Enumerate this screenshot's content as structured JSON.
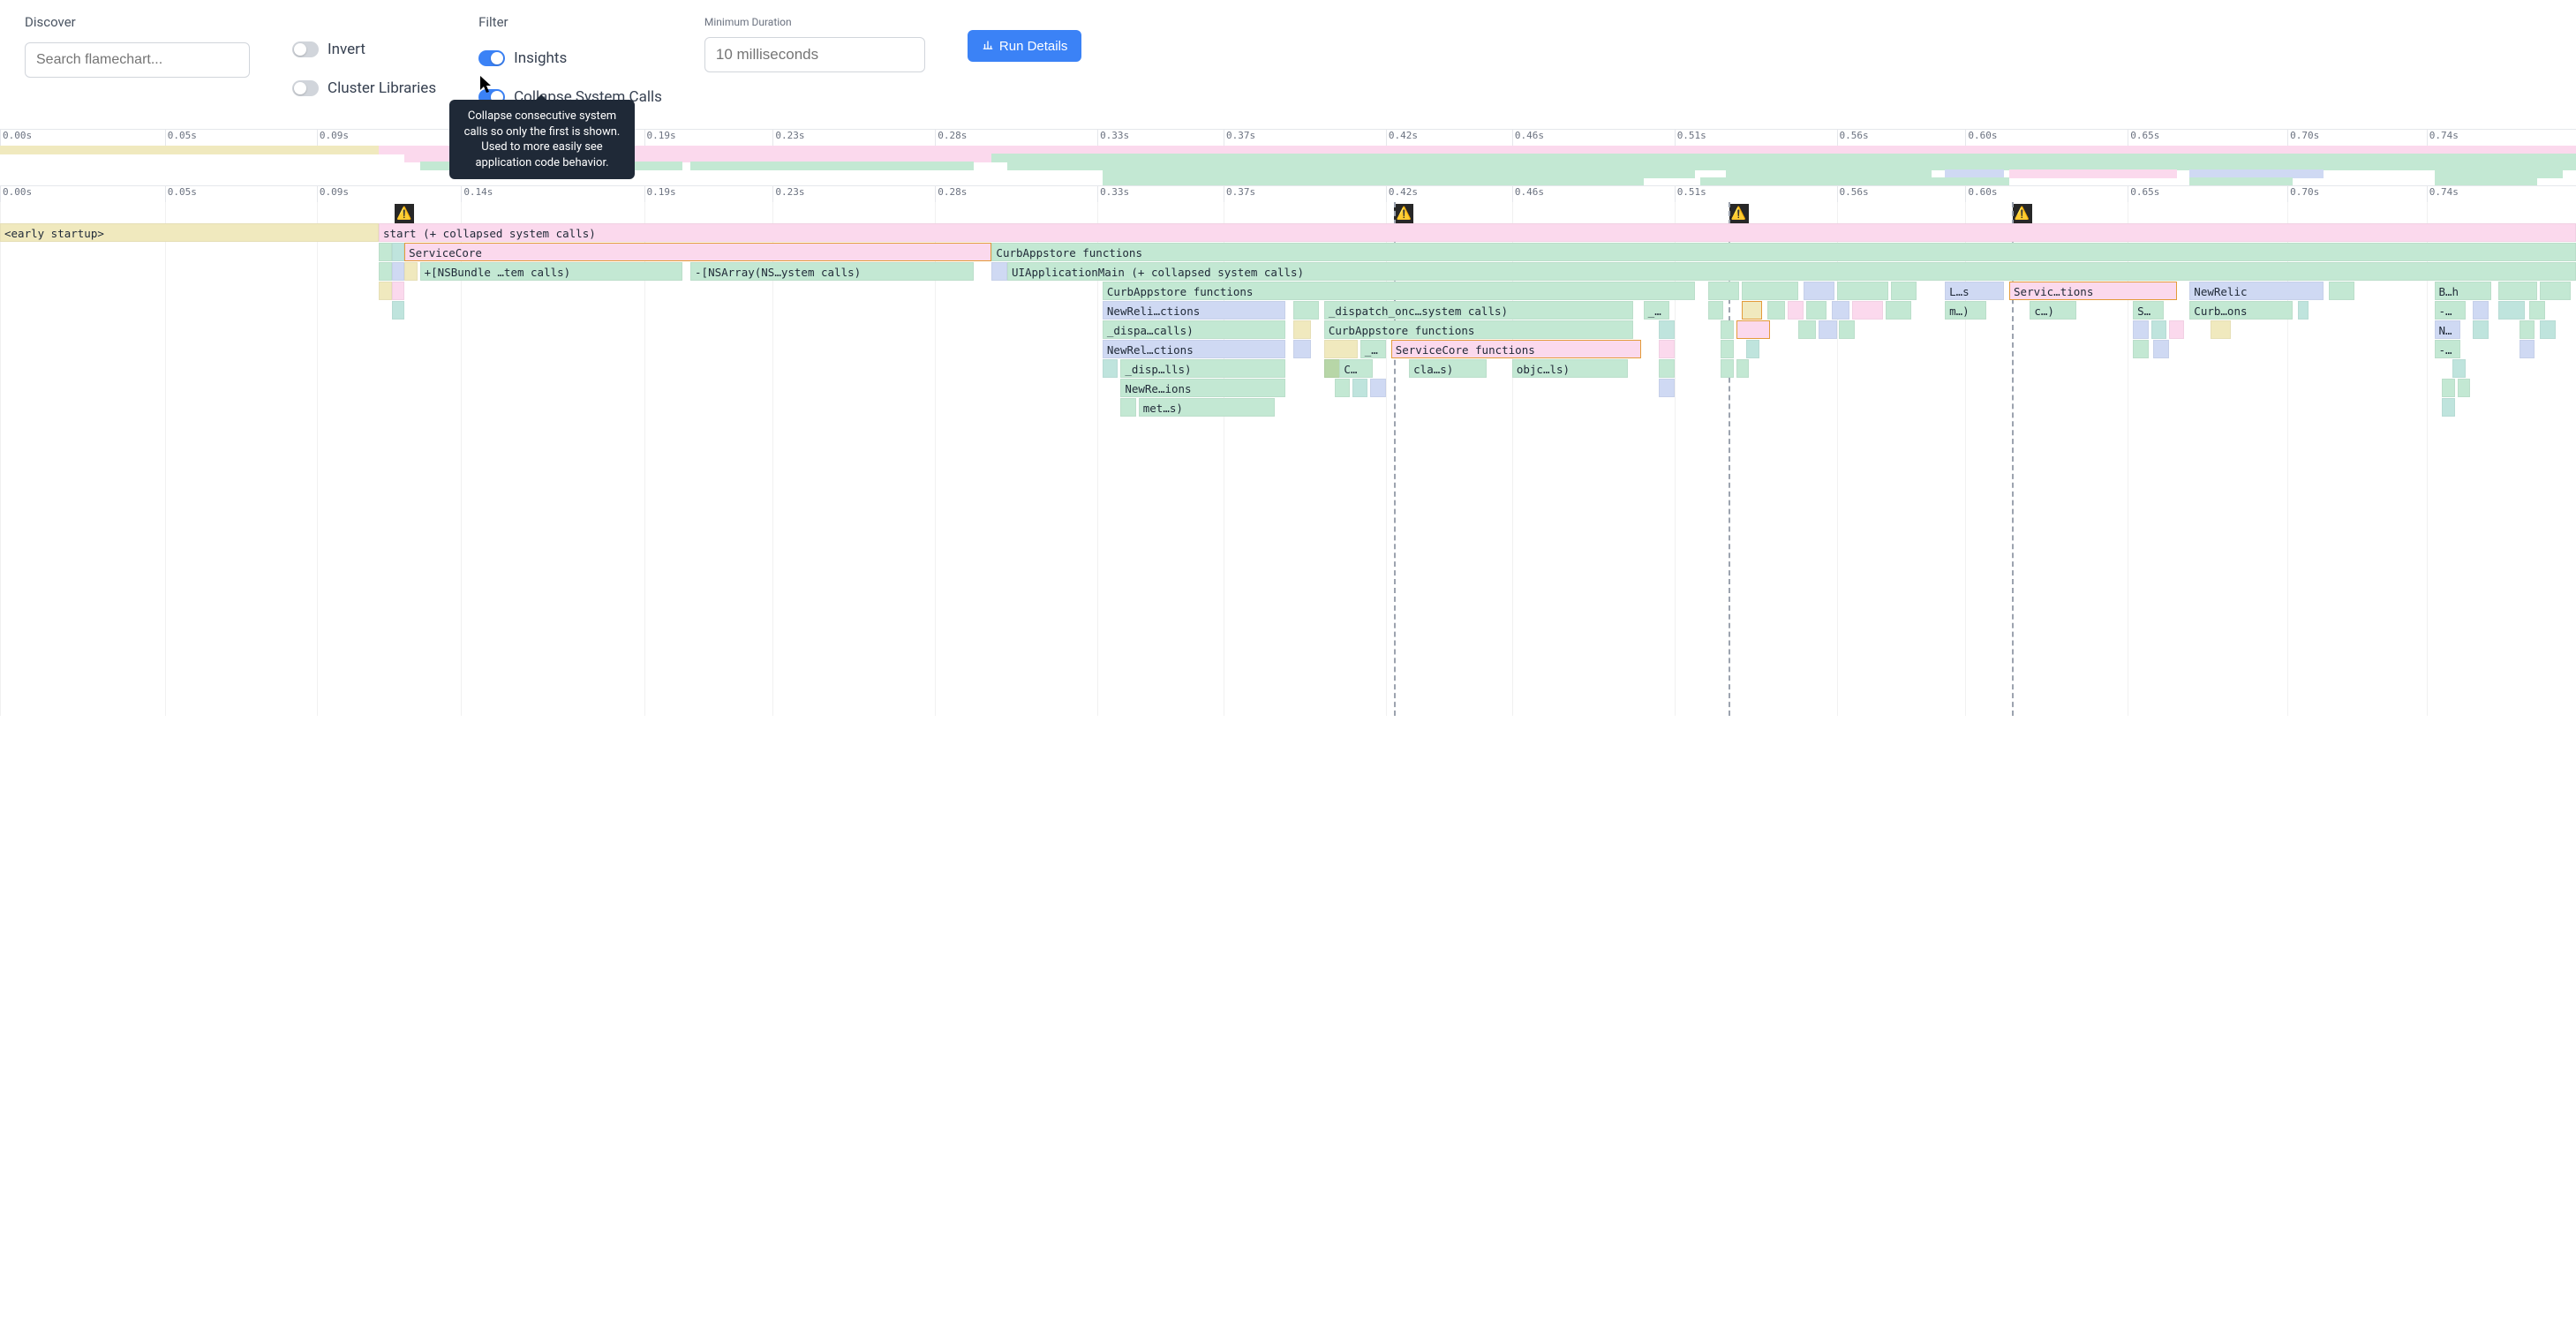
{
  "toolbar": {
    "discover_label": "Discover",
    "search_placeholder": "Search flamechart...",
    "invert_label": "Invert",
    "cluster_label": "Cluster Libraries",
    "filter_label": "Filter",
    "insights_label": "Insights",
    "collapse_label": "Collapse System Calls",
    "mindur_label": "Minimum Duration",
    "mindur_placeholder": "10 milliseconds",
    "run_label": "Run Details",
    "invert_on": false,
    "cluster_on": false,
    "insights_on": true,
    "collapse_on": true
  },
  "tooltip_text": "Collapse consecutive system calls so only the first is shown. Used to more easily see application code behavior.",
  "ruler_ticks": [
    "0.00s",
    "0.05s",
    "0.09s",
    "0.14s",
    "0.19s",
    "0.23s",
    "0.28s",
    "0.33s",
    "0.37s",
    "0.42s",
    "0.46s",
    "0.51s",
    "0.56s",
    "0.60s",
    "0.65s",
    "0.70s",
    "0.74s"
  ],
  "ruler_pct": [
    0,
    6.4,
    12.3,
    17.9,
    25.0,
    30.0,
    36.3,
    42.6,
    47.5,
    53.8,
    58.7,
    65.0,
    71.3,
    76.3,
    82.6,
    88.8,
    94.2,
    100
  ],
  "warnings_pct": [
    15.7,
    54.5,
    67.5,
    78.5
  ],
  "vdash_pct": [
    54.1,
    67.1,
    78.1
  ],
  "flame_rows": [
    [
      {
        "l": 0,
        "w": 14.7,
        "cls": "c-yellow",
        "txt": "<early startup>"
      },
      {
        "l": 14.7,
        "w": 85.3,
        "cls": "c-pink",
        "txt": "start (+ collapsed system calls)"
      }
    ],
    [
      {
        "l": 14.7,
        "w": 0.5,
        "cls": "c-green",
        "txt": ""
      },
      {
        "l": 15.2,
        "w": 0.5,
        "cls": "c-teal",
        "txt": ""
      },
      {
        "l": 15.7,
        "w": 22.8,
        "cls": "c-pink-b",
        "txt": "ServiceCore"
      },
      {
        "l": 38.5,
        "w": 61.5,
        "cls": "c-green",
        "txt": "CurbAppstore functions"
      }
    ],
    [
      {
        "l": 14.7,
        "w": 0.5,
        "cls": "c-green",
        "txt": ""
      },
      {
        "l": 15.2,
        "w": 0.5,
        "cls": "c-blue",
        "txt": ""
      },
      {
        "l": 15.7,
        "w": 0.5,
        "cls": "c-yellow",
        "txt": ""
      },
      {
        "l": 16.3,
        "w": 10.2,
        "cls": "c-green",
        "txt": "+[NSBundle …tem calls)"
      },
      {
        "l": 26.8,
        "w": 11.0,
        "cls": "c-green",
        "txt": "-[NSArray(NS…ystem calls)"
      },
      {
        "l": 38.5,
        "w": 0.6,
        "cls": "c-blue",
        "txt": ""
      },
      {
        "l": 39.1,
        "w": 60.9,
        "cls": "c-green",
        "txt": "UIApplicationMain (+ collapsed system calls)"
      }
    ],
    [
      {
        "l": 14.7,
        "w": 0.5,
        "cls": "c-yellow",
        "txt": ""
      },
      {
        "l": 15.2,
        "w": 0.5,
        "cls": "c-pink",
        "txt": ""
      },
      {
        "l": 42.8,
        "w": 23.0,
        "cls": "c-green",
        "txt": "CurbAppstore functions"
      },
      {
        "l": 66.3,
        "w": 1.2,
        "cls": "c-green",
        "txt": ""
      },
      {
        "l": 67.6,
        "w": 2.2,
        "cls": "c-green",
        "txt": ""
      },
      {
        "l": 70.0,
        "w": 1.2,
        "cls": "c-blue",
        "txt": ""
      },
      {
        "l": 71.3,
        "w": 2.0,
        "cls": "c-green",
        "txt": ""
      },
      {
        "l": 73.4,
        "w": 1.0,
        "cls": "c-green",
        "txt": ""
      },
      {
        "l": 75.5,
        "w": 2.3,
        "cls": "c-blue",
        "txt": "L…s"
      },
      {
        "l": 78.0,
        "w": 6.5,
        "cls": "c-pink-b",
        "txt": "Servic…tions"
      },
      {
        "l": 85.0,
        "w": 5.2,
        "cls": "c-blue",
        "txt": "NewRelic"
      },
      {
        "l": 90.4,
        "w": 1.0,
        "cls": "c-green",
        "txt": ""
      },
      {
        "l": 94.5,
        "w": 2.2,
        "cls": "c-green",
        "txt": "B…h"
      },
      {
        "l": 97.0,
        "w": 1.5,
        "cls": "c-green",
        "txt": ""
      },
      {
        "l": 98.6,
        "w": 1.2,
        "cls": "c-green",
        "txt": ""
      }
    ],
    [
      {
        "l": 15.2,
        "w": 0.5,
        "cls": "c-teal",
        "txt": ""
      },
      {
        "l": 42.8,
        "w": 7.1,
        "cls": "c-blue",
        "txt": "NewReli…ctions"
      },
      {
        "l": 50.2,
        "w": 1.0,
        "cls": "c-green",
        "txt": ""
      },
      {
        "l": 51.4,
        "w": 12.0,
        "cls": "c-green",
        "txt": "_dispatch_onc…system calls)"
      },
      {
        "l": 63.8,
        "w": 1.0,
        "cls": "c-green",
        "txt": "_…"
      },
      {
        "l": 66.3,
        "w": 0.6,
        "cls": "c-green",
        "txt": ""
      },
      {
        "l": 67.6,
        "w": 0.8,
        "cls": "c-yellow-b",
        "txt": ""
      },
      {
        "l": 68.6,
        "w": 0.7,
        "cls": "c-green",
        "txt": ""
      },
      {
        "l": 69.4,
        "w": 0.6,
        "cls": "c-pink",
        "txt": ""
      },
      {
        "l": 70.1,
        "w": 0.8,
        "cls": "c-green",
        "txt": ""
      },
      {
        "l": 71.1,
        "w": 0.7,
        "cls": "c-blue",
        "txt": ""
      },
      {
        "l": 71.9,
        "w": 1.2,
        "cls": "c-pink",
        "txt": ""
      },
      {
        "l": 73.2,
        "w": 1.0,
        "cls": "c-green",
        "txt": ""
      },
      {
        "l": 75.5,
        "w": 1.6,
        "cls": "c-green",
        "txt": "m…)"
      },
      {
        "l": 78.8,
        "w": 1.8,
        "cls": "c-green",
        "txt": "c…)"
      },
      {
        "l": 82.8,
        "w": 1.2,
        "cls": "c-green",
        "txt": "S…"
      },
      {
        "l": 85.0,
        "w": 4.0,
        "cls": "c-green",
        "txt": "Curb…ons"
      },
      {
        "l": 89.2,
        "w": 0.4,
        "cls": "c-teal",
        "txt": ""
      },
      {
        "l": 94.5,
        "w": 1.2,
        "cls": "c-green",
        "txt": "-…"
      },
      {
        "l": 96.0,
        "w": 0.6,
        "cls": "c-blue",
        "txt": ""
      },
      {
        "l": 97.0,
        "w": 1.0,
        "cls": "c-teal",
        "txt": ""
      },
      {
        "l": 98.2,
        "w": 0.6,
        "cls": "c-green",
        "txt": ""
      }
    ],
    [
      {
        "l": 42.8,
        "w": 7.1,
        "cls": "c-green",
        "txt": "_dispa…calls)"
      },
      {
        "l": 50.2,
        "w": 0.7,
        "cls": "c-yellow",
        "txt": ""
      },
      {
        "l": 51.4,
        "w": 12.0,
        "cls": "c-green",
        "txt": "CurbAppstore functions"
      },
      {
        "l": 64.4,
        "w": 0.6,
        "cls": "c-teal",
        "txt": ""
      },
      {
        "l": 66.8,
        "w": 0.5,
        "cls": "c-green",
        "txt": ""
      },
      {
        "l": 67.4,
        "w": 1.3,
        "cls": "c-pink-b",
        "txt": ""
      },
      {
        "l": 69.8,
        "w": 0.7,
        "cls": "c-green",
        "txt": ""
      },
      {
        "l": 70.6,
        "w": 0.7,
        "cls": "c-blue",
        "txt": ""
      },
      {
        "l": 71.4,
        "w": 0.6,
        "cls": "c-green",
        "txt": ""
      },
      {
        "l": 82.8,
        "w": 0.6,
        "cls": "c-blue",
        "txt": ""
      },
      {
        "l": 83.5,
        "w": 0.6,
        "cls": "c-teal",
        "txt": ""
      },
      {
        "l": 84.2,
        "w": 0.6,
        "cls": "c-pink",
        "txt": ""
      },
      {
        "l": 85.8,
        "w": 0.8,
        "cls": "c-yellow",
        "txt": ""
      },
      {
        "l": 94.5,
        "w": 1.0,
        "cls": "c-blue",
        "txt": "N…"
      },
      {
        "l": 96.0,
        "w": 0.6,
        "cls": "c-teal",
        "txt": ""
      },
      {
        "l": 97.8,
        "w": 0.6,
        "cls": "c-green",
        "txt": ""
      },
      {
        "l": 98.6,
        "w": 0.6,
        "cls": "c-teal",
        "txt": ""
      }
    ],
    [
      {
        "l": 42.8,
        "w": 7.1,
        "cls": "c-blue",
        "txt": "NewRel…ctions"
      },
      {
        "l": 50.2,
        "w": 0.7,
        "cls": "c-blue",
        "txt": ""
      },
      {
        "l": 51.4,
        "w": 1.3,
        "cls": "c-yellow",
        "txt": ""
      },
      {
        "l": 52.8,
        "w": 1.0,
        "cls": "c-green",
        "txt": "_…"
      },
      {
        "l": 54.0,
        "w": 9.7,
        "cls": "c-pink-b",
        "txt": "ServiceCore functions"
      },
      {
        "l": 64.4,
        "w": 0.6,
        "cls": "c-pink",
        "txt": ""
      },
      {
        "l": 66.8,
        "w": 0.5,
        "cls": "c-green",
        "txt": ""
      },
      {
        "l": 67.8,
        "w": 0.5,
        "cls": "c-teal",
        "txt": ""
      },
      {
        "l": 82.8,
        "w": 0.6,
        "cls": "c-green",
        "txt": ""
      },
      {
        "l": 83.6,
        "w": 0.6,
        "cls": "c-blue",
        "txt": ""
      },
      {
        "l": 94.5,
        "w": 1.0,
        "cls": "c-green",
        "txt": "-…"
      },
      {
        "l": 97.8,
        "w": 0.6,
        "cls": "c-blue",
        "txt": ""
      }
    ],
    [
      {
        "l": 42.8,
        "w": 0.6,
        "cls": "c-teal",
        "txt": ""
      },
      {
        "l": 43.5,
        "w": 6.4,
        "cls": "c-green",
        "txt": "_disp…lls)"
      },
      {
        "l": 51.4,
        "w": 1.0,
        "cls": "c-dkgreen",
        "txt": ""
      },
      {
        "l": 52.0,
        "w": 1.3,
        "cls": "c-green",
        "txt": "C…"
      },
      {
        "l": 54.7,
        "w": 3.0,
        "cls": "c-green",
        "txt": "cla…s)"
      },
      {
        "l": 58.7,
        "w": 4.5,
        "cls": "c-green",
        "txt": "objc…ls)"
      },
      {
        "l": 64.4,
        "w": 0.6,
        "cls": "c-green",
        "txt": ""
      },
      {
        "l": 66.8,
        "w": 0.5,
        "cls": "c-green",
        "txt": ""
      },
      {
        "l": 67.4,
        "w": 0.5,
        "cls": "c-green",
        "txt": ""
      },
      {
        "l": 95.2,
        "w": 0.5,
        "cls": "c-teal",
        "txt": ""
      }
    ],
    [
      {
        "l": 43.5,
        "w": 6.4,
        "cls": "c-green",
        "txt": "NewRe…ions"
      },
      {
        "l": 51.8,
        "w": 0.6,
        "cls": "c-green",
        "txt": ""
      },
      {
        "l": 52.5,
        "w": 0.6,
        "cls": "c-teal",
        "txt": ""
      },
      {
        "l": 53.2,
        "w": 0.6,
        "cls": "c-blue",
        "txt": ""
      },
      {
        "l": 64.4,
        "w": 0.6,
        "cls": "c-blue",
        "txt": ""
      },
      {
        "l": 94.8,
        "w": 0.5,
        "cls": "c-green",
        "txt": ""
      },
      {
        "l": 95.4,
        "w": 0.5,
        "cls": "c-green",
        "txt": ""
      }
    ],
    [
      {
        "l": 43.5,
        "w": 0.6,
        "cls": "c-green",
        "txt": ""
      },
      {
        "l": 44.2,
        "w": 5.3,
        "cls": "c-green",
        "txt": "met…s)"
      },
      {
        "l": 94.8,
        "w": 0.5,
        "cls": "c-teal",
        "txt": ""
      }
    ]
  ],
  "minimap_rows": [
    [
      {
        "l": 0,
        "w": 14.7,
        "cls": "c-yellow"
      },
      {
        "l": 14.7,
        "w": 85.3,
        "cls": "c-pink"
      }
    ],
    [
      {
        "l": 15.7,
        "w": 22.8,
        "cls": "c-pink"
      },
      {
        "l": 38.5,
        "w": 61.5,
        "cls": "c-green"
      }
    ],
    [
      {
        "l": 16.3,
        "w": 10.2,
        "cls": "c-green"
      },
      {
        "l": 26.8,
        "w": 11.0,
        "cls": "c-green"
      },
      {
        "l": 39.1,
        "w": 60.9,
        "cls": "c-green"
      }
    ],
    [
      {
        "l": 42.8,
        "w": 23,
        "cls": "c-green"
      },
      {
        "l": 67,
        "w": 8,
        "cls": "c-green"
      },
      {
        "l": 75.5,
        "w": 2.3,
        "cls": "c-blue"
      },
      {
        "l": 78,
        "w": 6.5,
        "cls": "c-pink"
      },
      {
        "l": 85,
        "w": 5.2,
        "cls": "c-blue"
      },
      {
        "l": 94.5,
        "w": 5,
        "cls": "c-green"
      }
    ],
    [
      {
        "l": 42.8,
        "w": 21,
        "cls": "c-green"
      },
      {
        "l": 66,
        "w": 12,
        "cls": "c-green"
      },
      {
        "l": 85,
        "w": 4,
        "cls": "c-green"
      },
      {
        "l": 94.5,
        "w": 4,
        "cls": "c-green"
      }
    ]
  ]
}
